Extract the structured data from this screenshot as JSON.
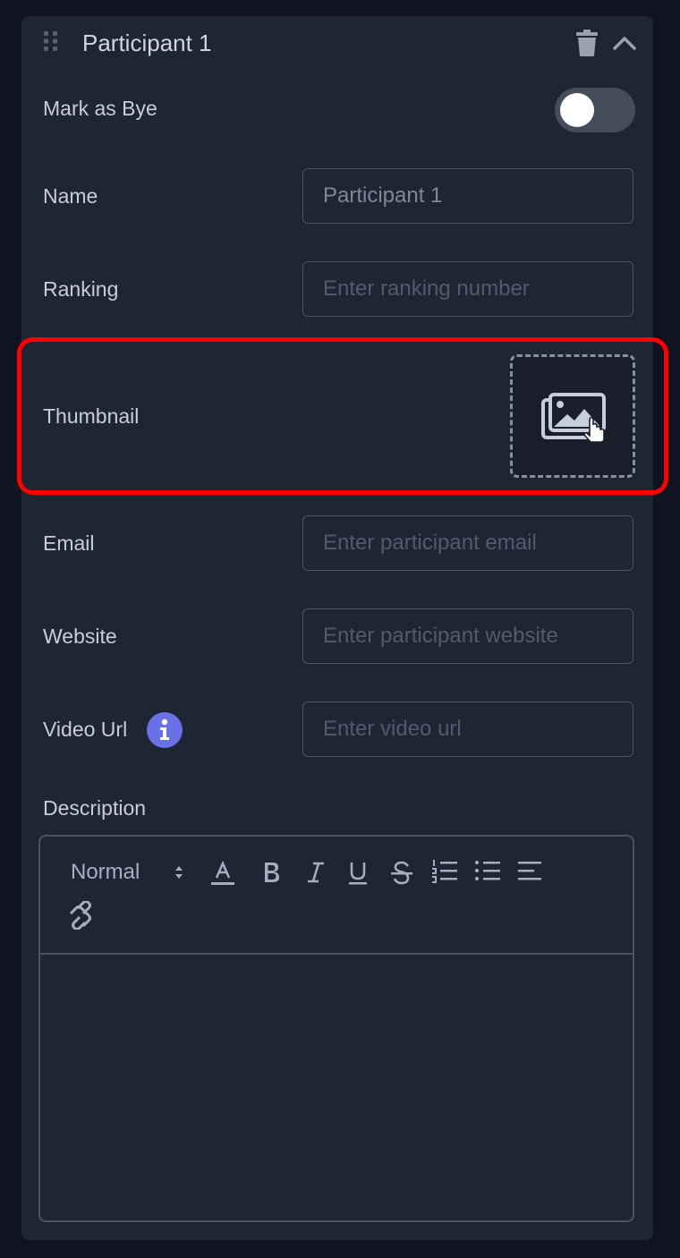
{
  "panel": {
    "title": "Participant 1"
  },
  "fields": {
    "bye_label": "Mark as Bye",
    "bye_on": false,
    "name_label": "Name",
    "name_value": "Participant 1",
    "ranking_label": "Ranking",
    "ranking_placeholder": "Enter ranking number",
    "thumbnail_label": "Thumbnail",
    "email_label": "Email",
    "email_placeholder": "Enter participant email",
    "website_label": "Website",
    "website_placeholder": "Enter participant website",
    "video_label": "Video Url",
    "video_placeholder": "Enter video url",
    "description_label": "Description"
  },
  "editor": {
    "format_value": "Normal",
    "content": ""
  },
  "icons": {
    "drag": "drag-handle-icon",
    "delete": "trash-icon",
    "collapse": "chevron-up-icon",
    "upload": "image-upload-icon",
    "info": "info-icon"
  },
  "colors": {
    "highlight": "#ff0000",
    "info_accent": "#6872e6",
    "toggle_track": "#454c5a"
  }
}
